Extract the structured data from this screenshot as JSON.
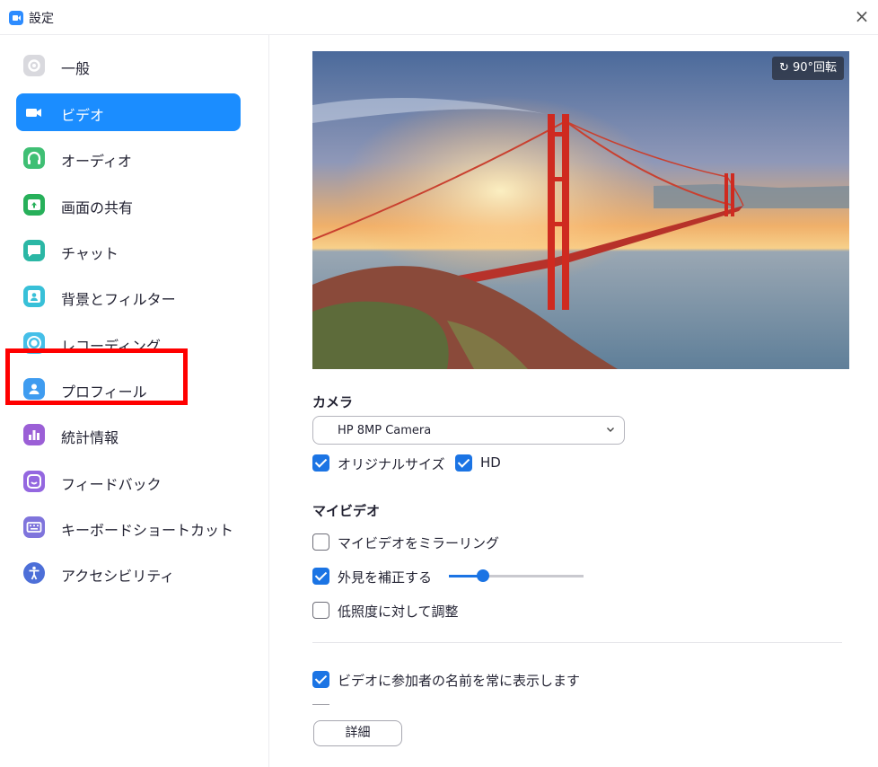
{
  "window": {
    "title": "設定"
  },
  "sidebar": {
    "items": [
      {
        "label": "一般",
        "icon": "gear-icon",
        "color": "#d9d9de",
        "active": false
      },
      {
        "label": "ビデオ",
        "icon": "video-camera-icon",
        "color": "#1b8dff",
        "active": true
      },
      {
        "label": "オーディオ",
        "icon": "headphones-icon",
        "color": "#3fbf74",
        "active": false
      },
      {
        "label": "画面の共有",
        "icon": "share-screen-icon",
        "color": "#27b05a",
        "active": false
      },
      {
        "label": "チャット",
        "icon": "chat-bubble-icon",
        "color": "#2bb7a5",
        "active": false
      },
      {
        "label": "背景とフィルター",
        "icon": "background-person-icon",
        "color": "#38c0d8",
        "active": false
      },
      {
        "label": "レコーディング",
        "icon": "record-icon",
        "color": "#45bfe8",
        "active": false
      },
      {
        "label": "プロフィール",
        "icon": "profile-icon",
        "color": "#3f9cf0",
        "active": false
      },
      {
        "label": "統計情報",
        "icon": "statistics-icon",
        "color": "#9b5fd6",
        "active": false
      },
      {
        "label": "フィードバック",
        "icon": "feedback-smile-icon",
        "color": "#9467e0",
        "active": false
      },
      {
        "label": "キーボードショートカット",
        "icon": "keyboard-icon",
        "color": "#7f74dc",
        "active": false
      },
      {
        "label": "アクセシビリティ",
        "icon": "accessibility-icon",
        "color": "#4d6fd8",
        "active": false
      }
    ]
  },
  "preview": {
    "rotate_label": "90°回転"
  },
  "camera": {
    "section_label": "カメラ",
    "selected": "HP 8MP Camera",
    "original_size_label": "オリジナルサイズ",
    "original_size_checked": true,
    "hd_label": "HD",
    "hd_checked": true
  },
  "my_video": {
    "section_label": "マイビデオ",
    "mirror_label": "マイビデオをミラーリング",
    "mirror_checked": false,
    "touch_up_label": "外見を補正する",
    "touch_up_checked": true,
    "touch_up_level": 0.25,
    "low_light_label": "低照度に対して調整",
    "low_light_checked": false
  },
  "names": {
    "always_show_label": "ビデオに参加者の名前を常に表示します",
    "always_show_checked": true
  },
  "detail_button": "詳細",
  "colors": {
    "accent": "#1b8dff",
    "highlight": "#ff0000"
  }
}
